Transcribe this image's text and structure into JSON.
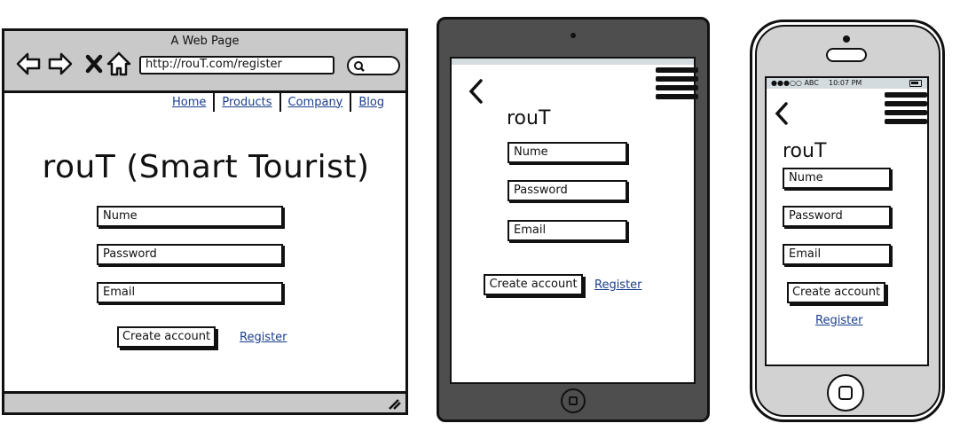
{
  "browser": {
    "title": "A Web Page",
    "url": "http://rouT.com/register",
    "nav_links": [
      "Home",
      "Products",
      "Company",
      "Blog"
    ],
    "heading": "rouT (Smart Tourist)",
    "fields": [
      "Nume",
      "Password",
      "Email"
    ],
    "create_button": "Create account",
    "register_link": "Register"
  },
  "tablet": {
    "title": "rouT",
    "fields": [
      "Nume",
      "Password",
      "Email"
    ],
    "create_button": "Create account",
    "register_link": "Register"
  },
  "phone": {
    "status_signal": "●●●○○ ABC",
    "status_time": "10:07 PM",
    "title": "rouT",
    "fields": [
      "Nume",
      "Password",
      "Email"
    ],
    "create_button": "Create account",
    "register_link": "Register"
  },
  "icons": [
    "back-arrow-icon",
    "forward-arrow-icon",
    "close-icon",
    "home-icon",
    "search-icon",
    "resize-grip-icon",
    "chevron-left-icon",
    "hamburger-menu-icon",
    "battery-icon",
    "home-button-icon"
  ]
}
